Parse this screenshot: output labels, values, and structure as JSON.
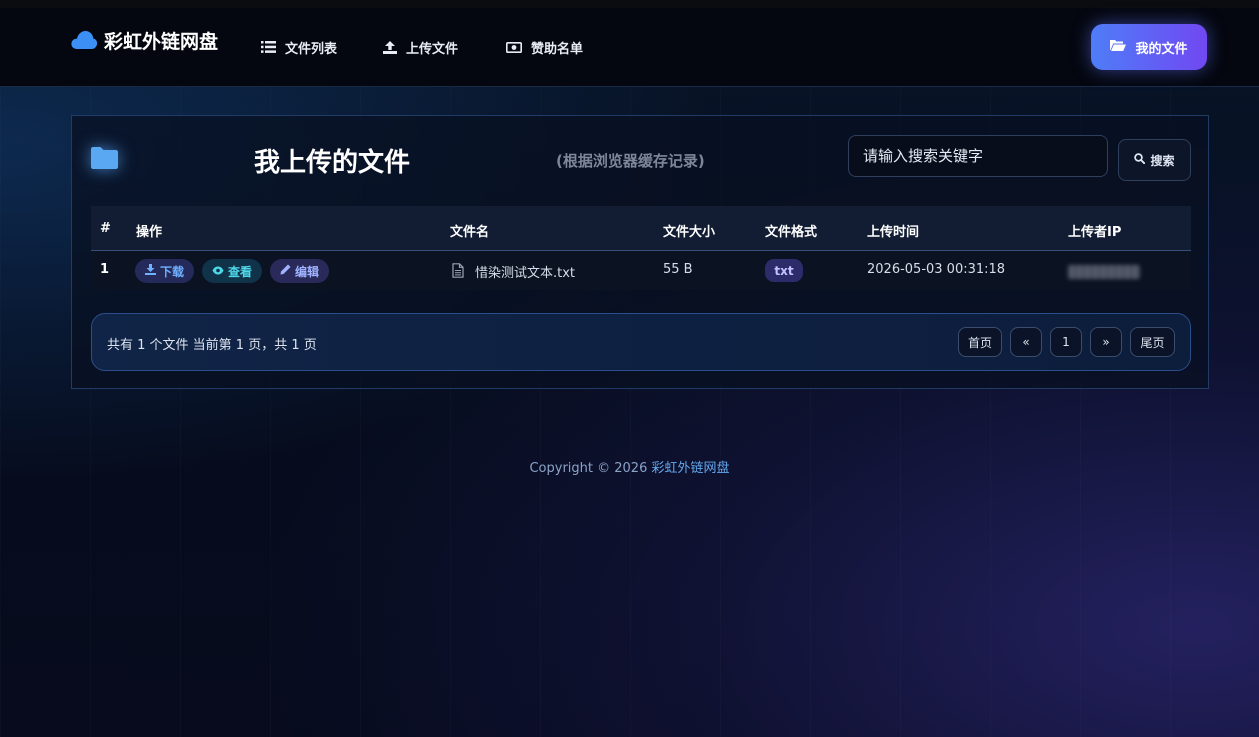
{
  "brand": {
    "name": "彩虹外链网盘",
    "icon": "cloud-icon"
  },
  "nav": {
    "items": [
      {
        "label": "文件列表",
        "icon": "list-icon"
      },
      {
        "label": "上传文件",
        "icon": "upload-icon"
      },
      {
        "label": "赞助名单",
        "icon": "money-icon"
      }
    ],
    "my_files_label": "我的文件",
    "my_files_icon": "folder-open-icon"
  },
  "panel": {
    "title": "我上传的文件",
    "subtitle": "(根据浏览器缓存记录)",
    "search_placeholder": "请输入搜索关键字",
    "search_label": "搜索"
  },
  "table": {
    "columns": [
      "#",
      "操作",
      "文件名",
      "文件大小",
      "文件格式",
      "上传时间",
      "上传者IP"
    ],
    "actions": {
      "download": "下载",
      "view": "查看",
      "edit": "编辑"
    },
    "rows": [
      {
        "num": "1",
        "filename": "惜染测试文本.txt",
        "size": "55 B",
        "format": "txt",
        "time": "2026-05-03 00:31:18"
      }
    ]
  },
  "pager": {
    "info": "共有 1 个文件  当前第 1 页，共 1 页",
    "first": "首页",
    "prev": "«",
    "current": "1",
    "next": "»",
    "last": "尾页"
  },
  "footer": {
    "copyright": "Copyright © 2026 ",
    "site_name": "彩虹外链网盘"
  },
  "colors": {
    "accent_start": "#4e7df7",
    "accent_end": "#7148f2",
    "link": "#63a8f0",
    "badge_bg": "#2d2c6a"
  }
}
